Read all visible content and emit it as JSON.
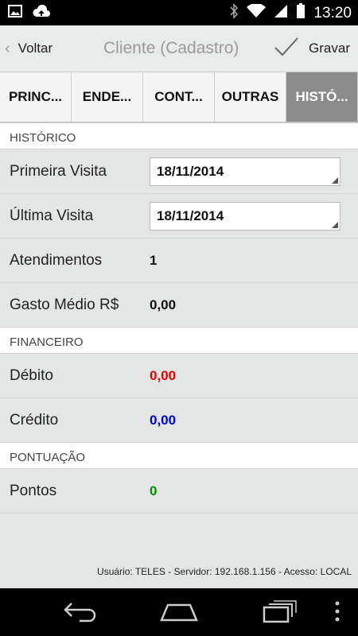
{
  "status_bar": {
    "time": "13:20"
  },
  "action_bar": {
    "back_label": "Voltar",
    "title": "Cliente (Cadastro)",
    "save_label": "Gravar"
  },
  "tabs": [
    {
      "label": "PRINC..."
    },
    {
      "label": "ENDE..."
    },
    {
      "label": "CONT..."
    },
    {
      "label": "OUTRAS"
    },
    {
      "label": "HISTÓ..."
    }
  ],
  "historico": {
    "header": "HISTÓRICO",
    "primeira_visita": {
      "label": "Primeira Visita",
      "value": "18/11/2014"
    },
    "ultima_visita": {
      "label": "Última Visita",
      "value": "18/11/2014"
    },
    "atendimentos": {
      "label": "Atendimentos",
      "value": "1"
    },
    "gasto_medio": {
      "label": "Gasto Médio R$",
      "value": "0,00"
    }
  },
  "financeiro": {
    "header": "FINANCEIRO",
    "debito": {
      "label": "Débito",
      "value": "0,00"
    },
    "credito": {
      "label": "Crédito",
      "value": "0,00"
    }
  },
  "pontuacao": {
    "header": "PONTUAÇÃO",
    "pontos": {
      "label": "Pontos",
      "value": "0"
    }
  },
  "footer": {
    "text": "Usuário: TELES - Servidor: 192.168.1.156 - Acesso: LOCAL"
  },
  "colors": {
    "debit": "#e00000",
    "credit": "#0000d0",
    "points": "#009000",
    "active_tab": "#8b8b8b"
  }
}
